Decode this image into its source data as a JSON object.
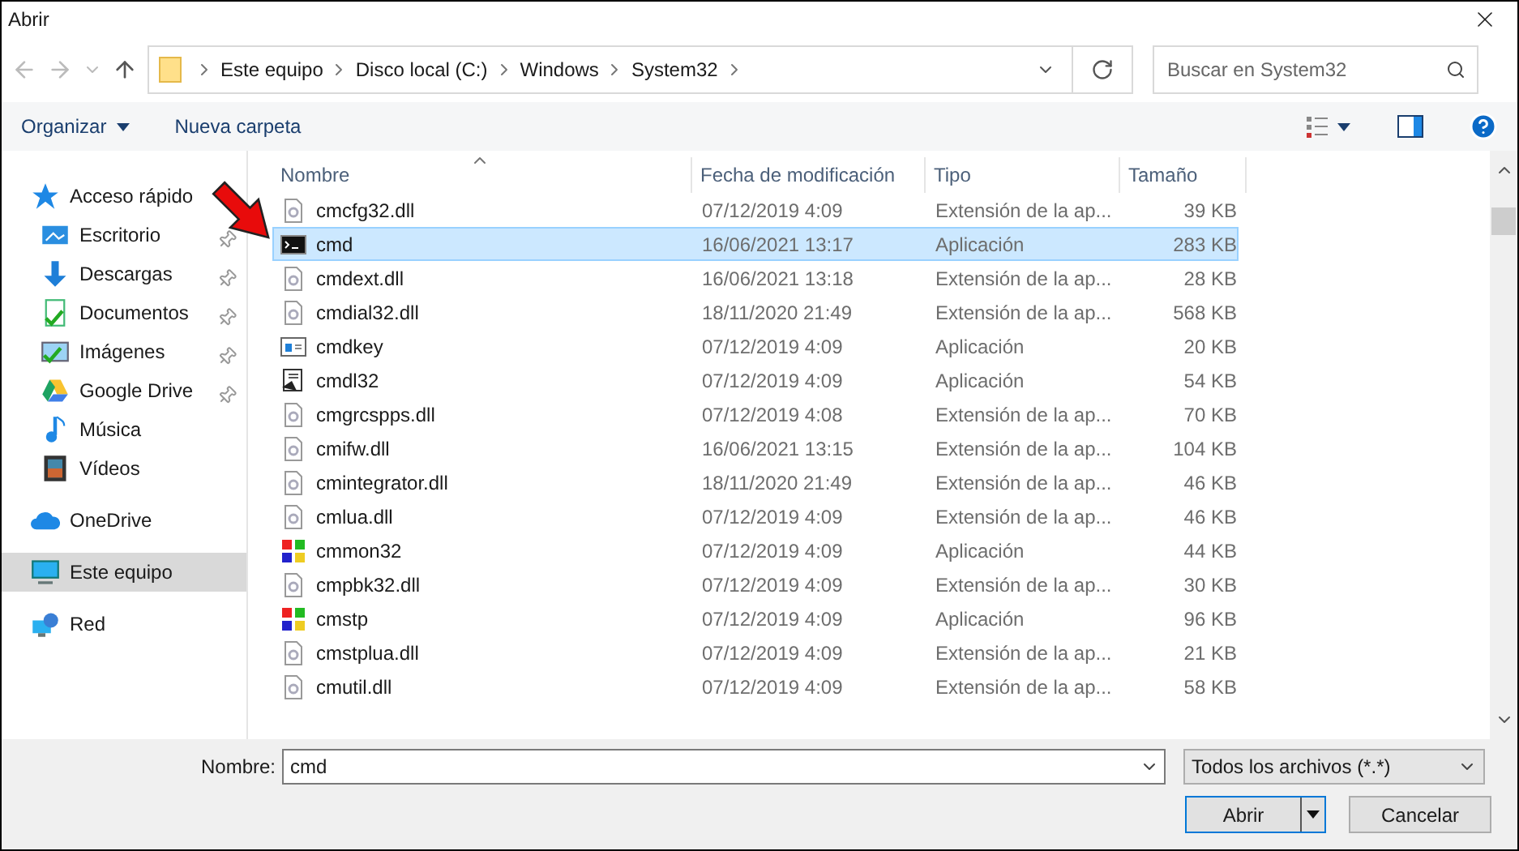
{
  "window": {
    "title": "Abrir"
  },
  "breadcrumb": [
    "Este equipo",
    "Disco local (C:)",
    "Windows",
    "System32"
  ],
  "search": {
    "placeholder": "Buscar en System32"
  },
  "toolbar": {
    "organize": "Organizar",
    "new_folder": "Nueva carpeta"
  },
  "sidebar": {
    "items": [
      {
        "label": "Acceso rápido",
        "kind": "star",
        "selected": false,
        "children": [
          {
            "label": "Escritorio",
            "kind": "desktop",
            "pinned": true,
            "selected": false
          },
          {
            "label": "Descargas",
            "kind": "download",
            "pinned": true,
            "selected": false
          },
          {
            "label": "Documentos",
            "kind": "document",
            "pinned": true,
            "selected": false
          },
          {
            "label": "Imágenes",
            "kind": "image",
            "pinned": true,
            "selected": false
          },
          {
            "label": "Google Drive",
            "kind": "drive",
            "pinned": true,
            "selected": false
          },
          {
            "label": "Música",
            "kind": "music",
            "pinned": false,
            "selected": false
          },
          {
            "label": "Vídeos",
            "kind": "video",
            "pinned": false,
            "selected": false
          }
        ]
      },
      {
        "label": "OneDrive",
        "kind": "cloud",
        "selected": false
      },
      {
        "label": "Este equipo",
        "kind": "computer",
        "selected": true
      },
      {
        "label": "Red",
        "kind": "network",
        "selected": false
      }
    ]
  },
  "table": {
    "columns": [
      "Nombre",
      "Fecha de modificación",
      "Tipo",
      "Tamaño"
    ],
    "rows": [
      {
        "name": "cmcfg32.dll",
        "date": "07/12/2019 4:09",
        "type": "Extensión de la ap...",
        "size": "39 KB",
        "kind": "dll",
        "selected": false
      },
      {
        "name": "cmd",
        "date": "16/06/2021 13:17",
        "type": "Aplicación",
        "size": "283 KB",
        "kind": "console",
        "selected": true
      },
      {
        "name": "cmdext.dll",
        "date": "16/06/2021 13:18",
        "type": "Extensión de la ap...",
        "size": "28 KB",
        "kind": "dll",
        "selected": false
      },
      {
        "name": "cmdial32.dll",
        "date": "18/11/2020 21:49",
        "type": "Extensión de la ap...",
        "size": "568 KB",
        "kind": "dll",
        "selected": false
      },
      {
        "name": "cmdkey",
        "date": "07/12/2019 4:09",
        "type": "Aplicación",
        "size": "20 KB",
        "kind": "window",
        "selected": false
      },
      {
        "name": "cmdl32",
        "date": "07/12/2019 4:09",
        "type": "Aplicación",
        "size": "54 KB",
        "kind": "phone",
        "selected": false
      },
      {
        "name": "cmgrcspps.dll",
        "date": "07/12/2019 4:08",
        "type": "Extensión de la ap...",
        "size": "70 KB",
        "kind": "dll",
        "selected": false
      },
      {
        "name": "cmifw.dll",
        "date": "16/06/2021 13:15",
        "type": "Extensión de la ap...",
        "size": "104 KB",
        "kind": "dll",
        "selected": false
      },
      {
        "name": "cmintegrator.dll",
        "date": "18/11/2020 21:49",
        "type": "Extensión de la ap...",
        "size": "46 KB",
        "kind": "dll",
        "selected": false
      },
      {
        "name": "cmlua.dll",
        "date": "07/12/2019 4:09",
        "type": "Extensión de la ap...",
        "size": "46 KB",
        "kind": "dll",
        "selected": false
      },
      {
        "name": "cmmon32",
        "date": "07/12/2019 4:09",
        "type": "Aplicación",
        "size": "44 KB",
        "kind": "colorful",
        "selected": false
      },
      {
        "name": "cmpbk32.dll",
        "date": "07/12/2019 4:09",
        "type": "Extensión de la ap...",
        "size": "30 KB",
        "kind": "dll",
        "selected": false
      },
      {
        "name": "cmstp",
        "date": "07/12/2019 4:09",
        "type": "Aplicación",
        "size": "96 KB",
        "kind": "colorful",
        "selected": false
      },
      {
        "name": "cmstplua.dll",
        "date": "07/12/2019 4:09",
        "type": "Extensión de la ap...",
        "size": "21 KB",
        "kind": "dll",
        "selected": false
      },
      {
        "name": "cmutil.dll",
        "date": "07/12/2019 4:09",
        "type": "Extensión de la ap...",
        "size": "58 KB",
        "kind": "dll",
        "selected": false
      }
    ]
  },
  "footer": {
    "name_label": "Nombre:",
    "name_value": "cmd",
    "filter": "Todos los archivos (*.*)",
    "open": "Abrir",
    "cancel": "Cancelar"
  }
}
